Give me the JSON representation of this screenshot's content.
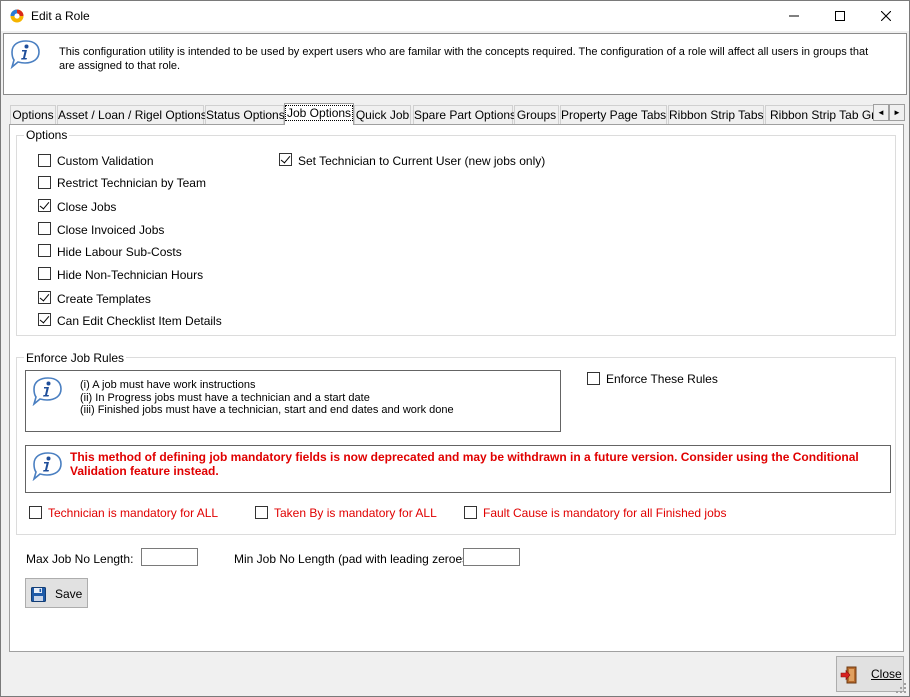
{
  "window": {
    "title": "Edit a Role",
    "minimize_icon": "minimize-icon",
    "maximize_icon": "maximize-icon",
    "close_icon": "close-icon"
  },
  "info": {
    "text": "This configuration utility is intended to be used by expert users who are familar with the concepts required. The configuration of a role will affect all users in groups that are assigned to that role."
  },
  "tabs": [
    {
      "label": "Options"
    },
    {
      "label": "Asset / Loan / Rigel Options"
    },
    {
      "label": "Status Options"
    },
    {
      "label": "Job Options"
    },
    {
      "label": "Quick Job"
    },
    {
      "label": "Spare Part Options"
    },
    {
      "label": "Groups"
    },
    {
      "label": "Property Page Tabs"
    },
    {
      "label": "Ribbon Strip Tabs"
    },
    {
      "label": "Ribbon Strip Tab Grou"
    }
  ],
  "active_tab": "Job Options",
  "tab_scroll": {
    "left": "◄",
    "right": "►"
  },
  "options_group": {
    "title": "Options",
    "left_items": [
      {
        "label": "Custom Validation",
        "checked": false
      },
      {
        "label": "Restrict Technician by Team",
        "checked": false
      },
      {
        "label": "Close Jobs",
        "checked": true
      },
      {
        "label": "Close Invoiced Jobs",
        "checked": false
      },
      {
        "label": "Hide Labour Sub-Costs",
        "checked": false
      },
      {
        "label": "Hide Non-Technician Hours",
        "checked": false
      },
      {
        "label": "Create Templates",
        "checked": true
      },
      {
        "label": "Can Edit Checklist Item Details",
        "checked": true
      }
    ],
    "right_items": [
      {
        "label": "Set Technician to Current User (new jobs only)",
        "checked": true
      }
    ]
  },
  "enforce_group": {
    "title": "Enforce Job Rules",
    "rules": [
      "(i)  A job must have work instructions",
      "(ii) In Progress jobs must have a technician and a start date",
      "(iii) Finished jobs must have a technician, start and end dates and work done"
    ],
    "enforce_label": "Enforce These Rules",
    "enforce_checked": false,
    "warning": "This method of defining job mandatory fields is now deprecated and may be withdrawn in a future version. Consider using the Conditional Validation feature  instead.",
    "mandatory": [
      {
        "label": "Technician is mandatory for ALL",
        "checked": false
      },
      {
        "label": "Taken By is mandatory for ALL",
        "checked": false
      },
      {
        "label": "Fault Cause is mandatory for all Finished jobs",
        "checked": false
      }
    ],
    "warning_color": "#e00000"
  },
  "lengths": {
    "max_label": "Max Job No Length:",
    "max_value": "",
    "min_label": "Min Job No Length (pad with leading zeroes):",
    "min_value": ""
  },
  "buttons": {
    "save": "Save",
    "save_icon": "floppy-disk-icon",
    "close": "Close",
    "close_icon": "exit-door-icon"
  }
}
